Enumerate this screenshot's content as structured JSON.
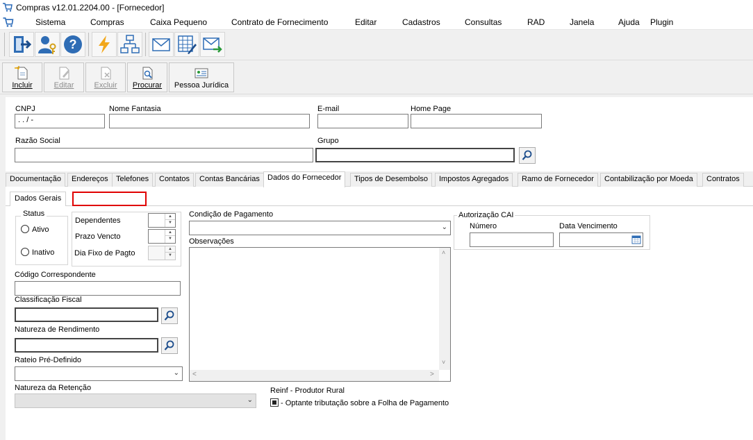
{
  "window": {
    "title": "Compras v12.01.2204.00 - [Fornecedor]",
    "icon": "cart-icon"
  },
  "menu": {
    "items": [
      "Sistema",
      "Compras",
      "Caixa Pequeno",
      "Contrato de Fornecimento",
      "Editar",
      "Cadastros",
      "Consultas",
      "RAD",
      "Janela",
      "Ajuda",
      "Plugin"
    ]
  },
  "toolbar": {
    "icons": [
      "exit-icon",
      "user-key-icon",
      "help-icon",
      "lightning-icon",
      "org-chart-icon",
      "mail-icon",
      "spreadsheet-edit-icon",
      "mail-forward-icon"
    ]
  },
  "actions": {
    "incluir": "Incluir",
    "editar": "Editar",
    "excluir": "Excluir",
    "procurar": "Procurar",
    "pessoa_juridica": "Pessoa Jurídica"
  },
  "header_fields": {
    "cnpj_label": "CNPJ",
    "cnpj_value": " .  .  /   -",
    "nome_fantasia_label": "Nome Fantasia",
    "email_label": "E-mail",
    "home_page_label": "Home Page",
    "razao_social_label": "Razão Social",
    "grupo_label": "Grupo"
  },
  "tabs": [
    "Documentação",
    "Endereços",
    "Telefones",
    "Contatos",
    "Contas Bancárias",
    "Dados do Fornecedor",
    "Tipos de Desembolso",
    "Impostos Agregados",
    "Ramo de Fornecedor",
    "Contabilização por Moeda",
    "Contratos"
  ],
  "active_tab": "Dados do Fornecedor",
  "subtabs": {
    "dados_gerais": "Dados Gerais"
  },
  "status_group": {
    "title": "Status",
    "ativo": "Ativo",
    "inativo": "Inativo"
  },
  "spin_fields": {
    "dependentes": "Dependentes",
    "prazo_vencto": "Prazo Vencto",
    "dia_fixo": "Dia Fixo de Pagto"
  },
  "left_fields": {
    "codigo_correspondente": "Código Correspondente",
    "classificacao_fiscal": "Classificação Fiscal",
    "natureza_rendimento": "Natureza de Rendimento",
    "rateio": "Rateio Pré-Definido",
    "natureza_retencao": "Natureza da Retenção"
  },
  "middle_fields": {
    "condicao_pagamento": "Condição de Pagamento",
    "observacoes": "Observações"
  },
  "cai": {
    "title": "Autorização CAI",
    "numero": "Número",
    "data_vencimento": "Data Vencimento"
  },
  "reinf": {
    "title": "Reinf - Produtor Rural",
    "checkbox_label": "- Optante tributação sobre a Folha de Pagamento"
  },
  "colors": {
    "highlight_red": "#e00000",
    "window_bg": "#f0f0f0"
  }
}
